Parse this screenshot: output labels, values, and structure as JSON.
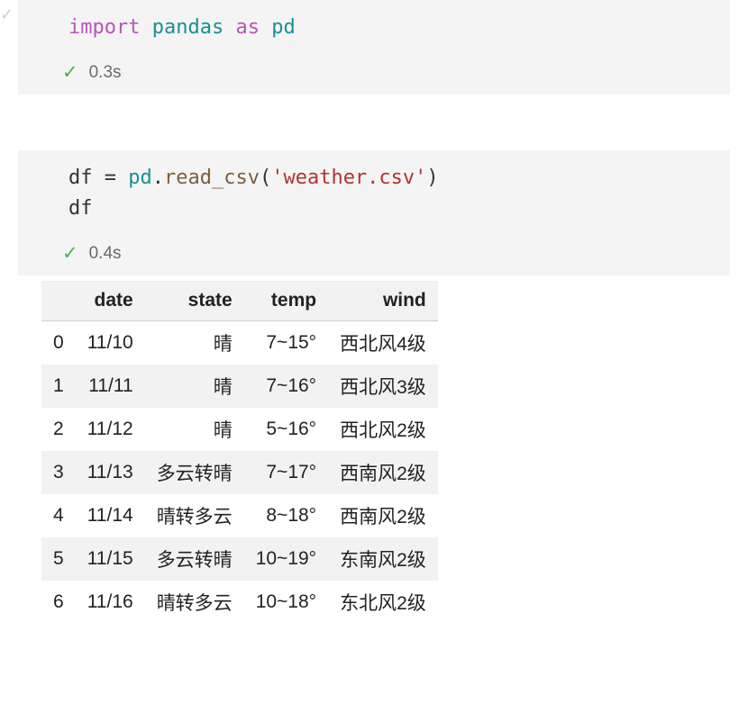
{
  "cells": [
    {
      "code_tokens": [
        {
          "t": "import",
          "cls": "kw"
        },
        {
          "t": " ",
          "cls": ""
        },
        {
          "t": "pandas",
          "cls": "mod"
        },
        {
          "t": " ",
          "cls": ""
        },
        {
          "t": "as",
          "cls": "kw"
        },
        {
          "t": " ",
          "cls": ""
        },
        {
          "t": "pd",
          "cls": "mod"
        }
      ],
      "status_check": "✓",
      "elapsed": "0.3s"
    },
    {
      "code_tokens": [
        {
          "t": "df",
          "cls": "var"
        },
        {
          "t": " ",
          "cls": ""
        },
        {
          "t": "=",
          "cls": "eq"
        },
        {
          "t": " ",
          "cls": ""
        },
        {
          "t": "pd",
          "cls": "mod"
        },
        {
          "t": ".",
          "cls": "pun"
        },
        {
          "t": "read_csv",
          "cls": "fn"
        },
        {
          "t": "(",
          "cls": "pun"
        },
        {
          "t": "'weather.csv'",
          "cls": "str"
        },
        {
          "t": ")",
          "cls": "pun"
        },
        {
          "t": "\n",
          "cls": ""
        },
        {
          "t": "df",
          "cls": "var"
        }
      ],
      "status_check": "✓",
      "elapsed": "0.4s"
    }
  ],
  "ghost_check": "✓",
  "table": {
    "columns": [
      "date",
      "state",
      "temp",
      "wind"
    ],
    "index": [
      "0",
      "1",
      "2",
      "3",
      "4",
      "5",
      "6"
    ],
    "rows": [
      [
        "11/10",
        "晴",
        "7~15°",
        "西北风4级"
      ],
      [
        "11/11",
        "晴",
        "7~16°",
        "西北风3级"
      ],
      [
        "11/12",
        "晴",
        "5~16°",
        "西北风2级"
      ],
      [
        "11/13",
        "多云转晴",
        "7~17°",
        "西南风2级"
      ],
      [
        "11/14",
        "晴转多云",
        "8~18°",
        "西南风2级"
      ],
      [
        "11/15",
        "多云转晴",
        "10~19°",
        "东南风2级"
      ],
      [
        "11/16",
        "晴转多云",
        "10~18°",
        "东北风2级"
      ]
    ]
  },
  "chart_data": {
    "type": "table",
    "title": "",
    "columns": [
      "date",
      "state",
      "temp",
      "wind"
    ],
    "rows": [
      {
        "date": "11/10",
        "state": "晴",
        "temp": "7~15°",
        "wind": "西北风4级"
      },
      {
        "date": "11/11",
        "state": "晴",
        "temp": "7~16°",
        "wind": "西北风3级"
      },
      {
        "date": "11/12",
        "state": "晴",
        "temp": "5~16°",
        "wind": "西北风2级"
      },
      {
        "date": "11/13",
        "state": "多云转晴",
        "temp": "7~17°",
        "wind": "西南风2级"
      },
      {
        "date": "11/14",
        "state": "晴转多云",
        "temp": "8~18°",
        "wind": "西南风2级"
      },
      {
        "date": "11/15",
        "state": "多云转晴",
        "temp": "10~19°",
        "wind": "东南风2级"
      },
      {
        "date": "11/16",
        "state": "晴转多云",
        "temp": "10~18°",
        "wind": "东北风2级"
      }
    ]
  }
}
